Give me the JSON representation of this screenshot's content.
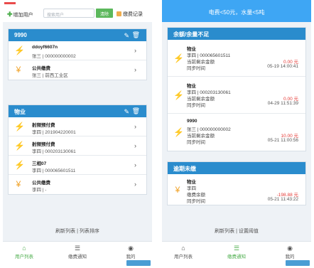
{
  "left": {
    "header": {
      "add_user": "增加用户",
      "search_placeholder": "搜索用户",
      "clear": "清除",
      "fee_record": "缴费记录"
    },
    "cards": [
      {
        "title": "9990",
        "items": [
          {
            "icon": "lightning-icon",
            "name": "ddoyf6607n",
            "detail": "张三 | 000000000002"
          },
          {
            "icon": "yen-icon",
            "name": "公共缴费",
            "detail": "张三 | 前西工业区"
          }
        ]
      },
      {
        "title": "物业",
        "items": [
          {
            "icon": "lightning-icon",
            "name": "射频预付费",
            "detail": "李四 | 201904220001"
          },
          {
            "icon": "lightning-icon",
            "name": "射频预付费",
            "detail": "李四 | 000203130061"
          },
          {
            "icon": "lightning-icon",
            "name": "三相07",
            "detail": "李四 | 000065601511"
          },
          {
            "icon": "yen-icon",
            "name": "公共缴费",
            "detail": "李四 | -"
          }
        ]
      }
    ],
    "footer_link": "刷新列表 | 列表排序",
    "tabs": [
      {
        "label": "用户列表",
        "active": true
      },
      {
        "label": "缴费通知",
        "active": false
      },
      {
        "label": "我的",
        "active": false
      }
    ]
  },
  "right": {
    "header": "电费<50元，水量<5吨",
    "sections": [
      {
        "title": "余额/余量不足",
        "items": [
          {
            "icon": "lightning-icon",
            "l1": "物业",
            "l2": "李四 | 000065601511",
            "l3": "当前剩余金额",
            "v3": "0.00 元",
            "l4": "同步时间",
            "v4": "05-19 14:00:41"
          },
          {
            "icon": "lightning-icon",
            "l1": "物业",
            "l2": "李四 | 000203130061",
            "l3": "当前剩余金额",
            "v3": "0.00 元",
            "l4": "同步时间",
            "v4": "04-29 11:51:39"
          },
          {
            "icon": "lightning-icon",
            "l1": "9990",
            "l2": "张三 | 000000000002",
            "l3": "当前剩余金额",
            "v3": "10.00 元",
            "l4": "同步时间",
            "v4": "05-21 11:00:56"
          }
        ]
      },
      {
        "title": "逾期未缴",
        "items": [
          {
            "icon": "yen-icon",
            "l1": "物业",
            "l2": "李四",
            "l3": "缴费余额",
            "v3": "-198.88 元",
            "l4": "同步时间",
            "v4": "05-21 11:43:22"
          }
        ]
      }
    ],
    "footer_link": "刷新列表 | 设置阈值",
    "tabs": [
      {
        "label": "用户列表",
        "active": false
      },
      {
        "label": "缴费通知",
        "active": true
      },
      {
        "label": "我的",
        "active": false
      }
    ]
  },
  "colors": {
    "accent": "#2a8ccd",
    "green": "#4cae4c",
    "warning": "#f0a32a",
    "red": "#e53935"
  }
}
